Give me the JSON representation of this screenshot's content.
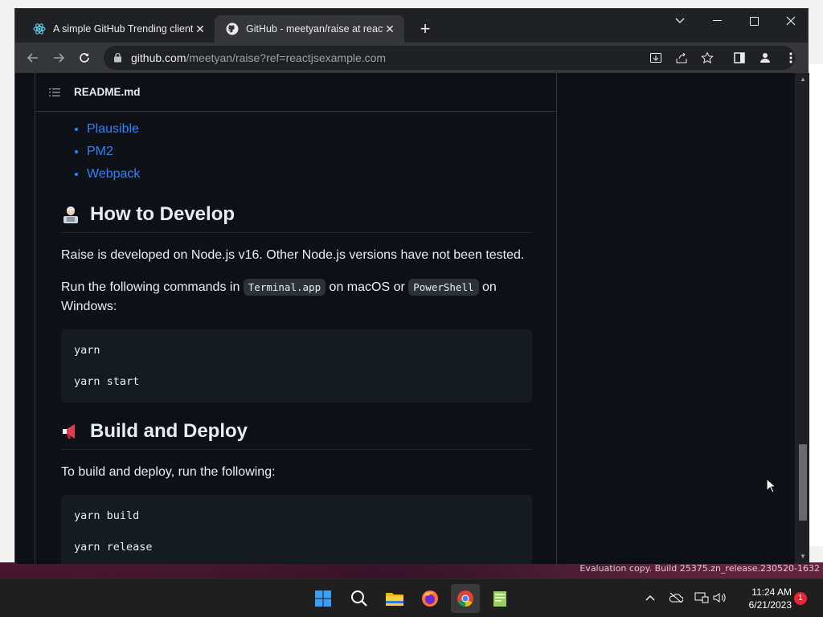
{
  "browser": {
    "tabs": [
      {
        "title": "A simple GitHub Trending client f",
        "active": false,
        "icon": "react-icon"
      },
      {
        "title": "GitHub - meetyan/raise at reactjs",
        "active": true,
        "icon": "github-icon"
      }
    ],
    "new_tab": "+",
    "url_host": "github.com",
    "url_path": "/meetyan/raise?ref=reactjsexample.com"
  },
  "readme": {
    "filename": "README.md",
    "list_items": [
      "Plausible",
      "PM2",
      "Webpack"
    ],
    "section_develop": {
      "heading": "How to Develop",
      "para1": "Raise is developed on Node.js v16. Other Node.js versions have not been tested.",
      "para2_prefix": "Run the following commands in ",
      "code1": "Terminal.app",
      "para2_mid": " on macOS or ",
      "code2": "PowerShell",
      "para2_suffix": " on Windows:",
      "code_lines": [
        "yarn",
        "yarn start"
      ]
    },
    "section_build": {
      "heading": "Build and Deploy",
      "para": "To build and deploy, run the following:",
      "code_lines": [
        "yarn build",
        "yarn release"
      ]
    }
  },
  "desktop": {
    "eval_text": "Evaluation copy. Build 25375.zn_release.230520-1632"
  },
  "taskbar": {
    "time": "11:24 AM",
    "date": "6/21/2023",
    "notification_count": "1"
  },
  "colors": {
    "link": "#2f81f7",
    "page_bg": "#0d1117",
    "chrome_bg": "#202124"
  }
}
